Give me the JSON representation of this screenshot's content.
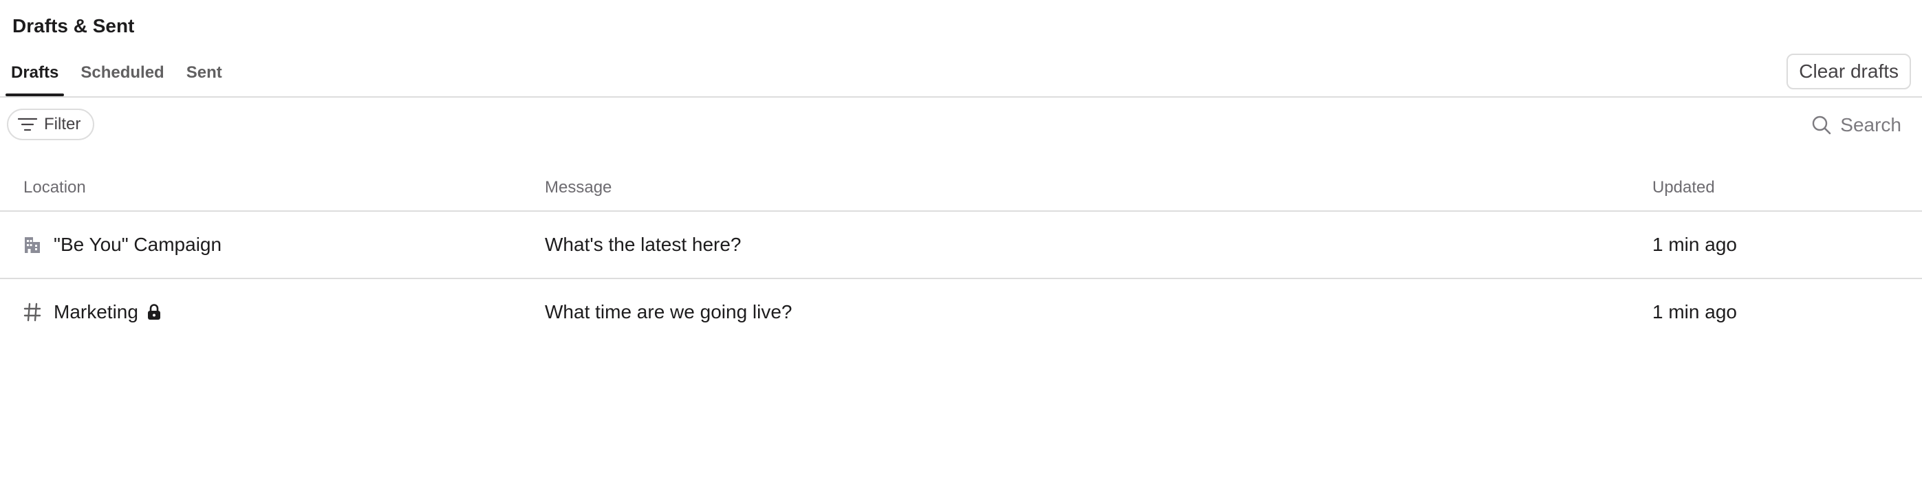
{
  "page": {
    "title": "Drafts & Sent"
  },
  "tabs": [
    {
      "label": "Drafts",
      "active": true
    },
    {
      "label": "Scheduled",
      "active": false
    },
    {
      "label": "Sent",
      "active": false
    }
  ],
  "toolbar": {
    "clear_label": "Clear drafts",
    "filter_label": "Filter",
    "search_label": "Search"
  },
  "table": {
    "columns": [
      "Location",
      "Message",
      "Updated"
    ],
    "rows": [
      {
        "location": "\"Be You\" Campaign",
        "location_icon": "building-icon",
        "private": false,
        "message": "What's the latest here?",
        "updated": "1 min ago"
      },
      {
        "location": "Marketing",
        "location_icon": "hash-icon",
        "private": true,
        "message": "What time are we going live?",
        "updated": "1 min ago"
      }
    ]
  },
  "colors": {
    "text": "#1d1c1d",
    "muted": "#616061",
    "border": "#dddddd"
  }
}
